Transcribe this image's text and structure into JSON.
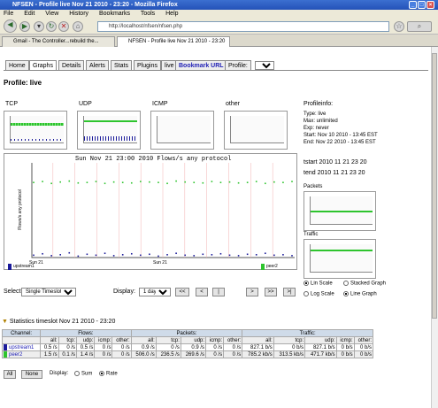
{
  "window": {
    "title": "NFSEN - Profile live Nov 21 2010 - 23:20 - Mozilla Firefox"
  },
  "menubar": {
    "items": [
      "File",
      "Edit",
      "View",
      "History",
      "Bookmarks",
      "Tools",
      "Help"
    ]
  },
  "nav": {
    "url": "http://localhost/nfsen/nfsen.php"
  },
  "browser_tabs": [
    {
      "label": "Gmail - The Controller...rebuild the..."
    },
    {
      "label": "NFSEN - Profile live Nov 21 2010 - 23:20"
    }
  ],
  "page_tabs": [
    "Home",
    "Graphs",
    "Details",
    "Alerts",
    "Stats",
    "Plugins",
    "live",
    "Bookmark URL",
    "Profile:"
  ],
  "profile_select": "live",
  "profile_title": "Profile: live",
  "small_graphs": [
    "TCP",
    "UDP",
    "ICMP",
    "other"
  ],
  "main_graph": {
    "title": "Sun Nov 21 23:00 2010 Flows/s any protocol",
    "ylabel": "Flows/s any protocol",
    "legend": [
      "upstream1",
      "peer2"
    ],
    "xlabel_day": "Sun 21"
  },
  "profileinfo": {
    "heading": "Profileinfo:",
    "lines": [
      "Type: live",
      "Max: unlimited",
      "Exp: never",
      "Start: Nov 10 2010 - 13:45 EST",
      "End: Nov 22 2010 - 13:45 EST"
    ],
    "tstart": "tstart 2010 11 21 23 20",
    "tend": "tend 2010 11 21 23 20",
    "packets_label": "Packets",
    "traffic_label": "Traffic"
  },
  "controls": {
    "select_label": "Select",
    "select_value": "Single Timeslot",
    "display_label": "Display:",
    "display_value": "1 day",
    "nav_buttons": [
      "<<",
      "<",
      "|",
      ">",
      ">>",
      ">|"
    ],
    "radio_lin": "Lin Scale",
    "radio_stacked": "Stacked Graph",
    "radio_log": "Log Scale",
    "radio_line": "Line Graph"
  },
  "stats": {
    "heading": "Statistics timeslot Nov 21 2010 - 23:20",
    "groups": [
      "Channel:",
      "Flows:",
      "Packets:",
      "Traffic:"
    ],
    "subheads": [
      "all:",
      "tcp:",
      "udp:",
      "icmp:",
      "other:",
      "all:",
      "tcp:",
      "udp:",
      "icmp:",
      "other:",
      "all:",
      "tcp:",
      "udp:",
      "icmp:",
      "other:"
    ],
    "rows": [
      {
        "channel": "upstream1",
        "color": "#1a1a9a",
        "cells": [
          "0.5 /s",
          "0 /s",
          "0.5 /s",
          "0 /s",
          "0 /s",
          "0.9 /s",
          "0 /s",
          "0.9 /s",
          "0 /s",
          "0 /s",
          "827.1 b/s",
          "0 b/s",
          "827.1 b/s",
          "0 b/s",
          "0 b/s"
        ]
      },
      {
        "channel": "peer2",
        "color": "#2ec42e",
        "cells": [
          "1.5 /s",
          "0.1 /s",
          "1.4 /s",
          "0 /s",
          "0 /s",
          "506.0 /s",
          "236.5 /s",
          "269.6 /s",
          "0 /s",
          "0 /s",
          "785.2 kb/s",
          "313.5 kb/s",
          "471.7 kb/s",
          "0 b/s",
          "0 b/s"
        ]
      }
    ],
    "btn_all": "All",
    "btn_none": "None",
    "display_label": "Display:",
    "radio_sum": "Sum",
    "radio_rate": "Rate"
  },
  "colors": {
    "upstream": "#1a1a9a",
    "peer": "#2ec42e",
    "titlebar": "#2452b8"
  },
  "chart_data": {
    "type": "scatter",
    "series": [
      {
        "name": "peer2",
        "values": [
          160,
          162,
          158,
          161,
          163,
          159,
          160,
          162,
          158,
          161,
          160,
          159,
          162,
          161,
          160,
          158,
          163,
          161,
          160,
          159,
          162,
          160,
          161,
          159,
          160,
          162,
          158,
          161,
          160,
          162
        ]
      },
      {
        "name": "upstream1",
        "values": [
          5,
          8,
          4,
          6,
          10,
          3,
          7,
          5,
          9,
          4,
          6,
          8,
          5,
          7,
          3,
          6,
          9,
          5,
          4,
          7,
          6,
          8,
          5,
          4,
          7,
          6,
          9,
          5,
          6,
          4
        ]
      }
    ],
    "ylim": [
      0,
      200
    ]
  }
}
